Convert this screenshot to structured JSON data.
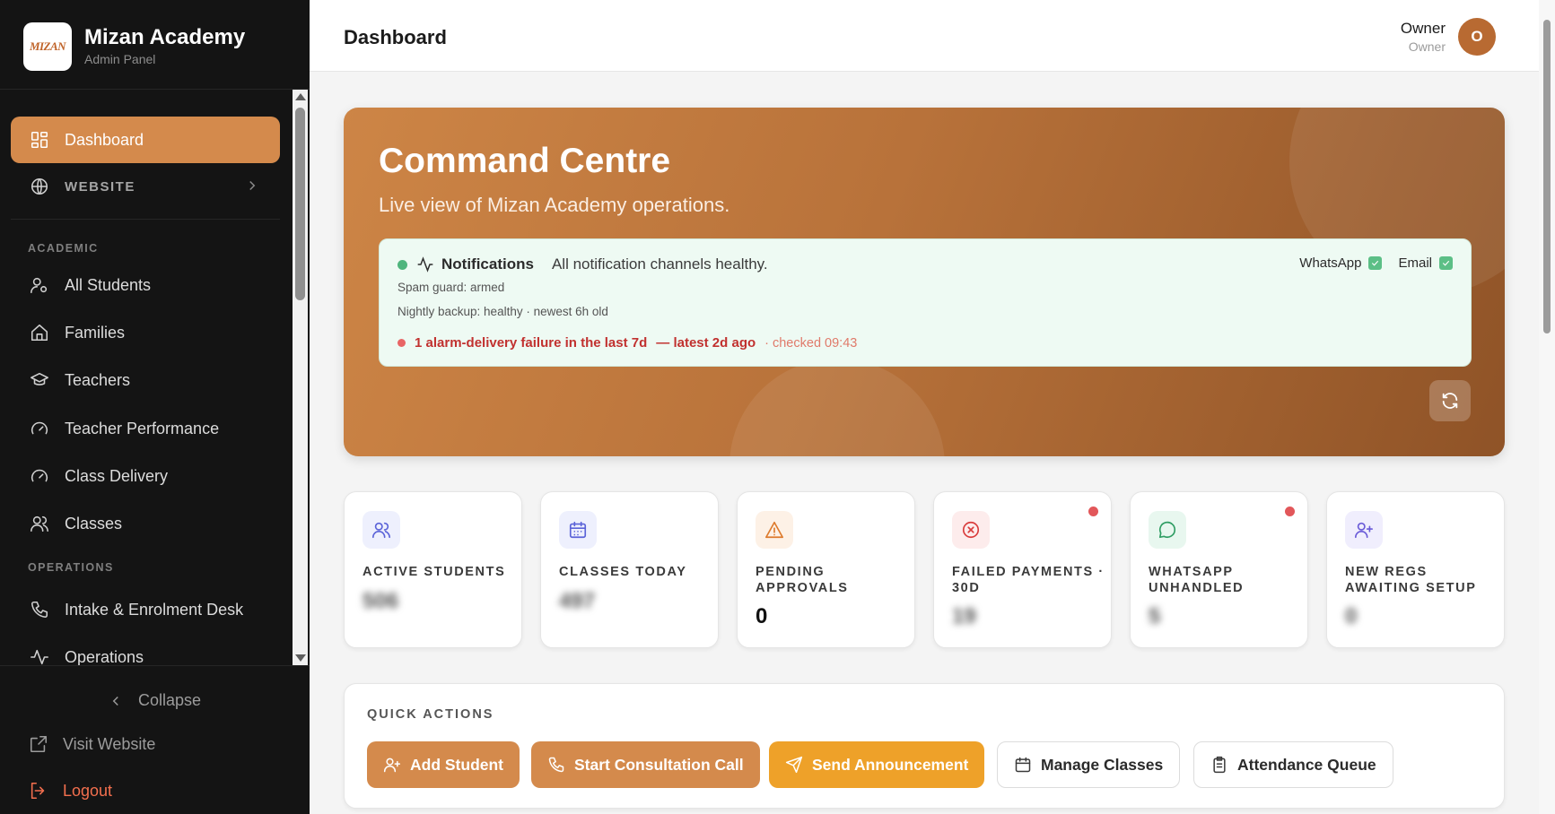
{
  "brand": {
    "logo_text": "MIZAN",
    "title": "Mizan Academy",
    "subtitle": "Admin Panel"
  },
  "sidebar": {
    "dashboard": "Dashboard",
    "website": "WEBSITE",
    "section_academic": "ACADEMIC",
    "all_students": "All Students",
    "families": "Families",
    "teachers": "Teachers",
    "teacher_performance": "Teacher Performance",
    "class_delivery": "Class Delivery",
    "classes": "Classes",
    "section_operations": "OPERATIONS",
    "intake": "Intake & Enrolment Desk",
    "operations": "Operations",
    "collapse": "Collapse",
    "visit_website": "Visit Website",
    "logout": "Logout"
  },
  "header": {
    "title": "Dashboard",
    "user_name": "Owner",
    "user_role": "Owner",
    "avatar_initial": "O"
  },
  "hero": {
    "title": "Command Centre",
    "subtitle": "Live view of Mizan Academy operations.",
    "notifications": {
      "label": "Notifications",
      "status": "All notification channels healthy.",
      "whatsapp": "WhatsApp",
      "email": "Email",
      "spam_guard": "Spam guard: armed",
      "backup": "Nightly backup: healthy · newest 6h old",
      "alarm": "1 alarm-delivery failure in the last 7d",
      "alarm_latest": "— latest 2d ago",
      "checked": "· checked 09:43"
    }
  },
  "stats": [
    {
      "label": "ACTIVE STUDENTS",
      "value": "506",
      "blurred": true
    },
    {
      "label": "CLASSES TODAY",
      "value": "497",
      "blurred": true
    },
    {
      "label": "PENDING APPROVALS",
      "value": "0",
      "blurred": false
    },
    {
      "label": "FAILED PAYMENTS · 30D",
      "value": "19",
      "blurred": true
    },
    {
      "label": "WHATSAPP UNHANDLED",
      "value": "5",
      "blurred": true
    },
    {
      "label": "NEW REGS AWAITING SETUP",
      "value": "0",
      "blurred": true
    }
  ],
  "quick_actions": {
    "title": "QUICK ACTIONS",
    "add_student": "Add Student",
    "start_call": "Start Consultation Call",
    "send_announcement": "Send Announcement",
    "manage_classes": "Manage Classes",
    "attendance_queue": "Attendance Queue"
  },
  "colors": {
    "accent": "#d48a4c",
    "amber": "#eea129",
    "sidebar_bg": "#141414",
    "danger": "#c1312f",
    "success": "#4fb57d"
  }
}
